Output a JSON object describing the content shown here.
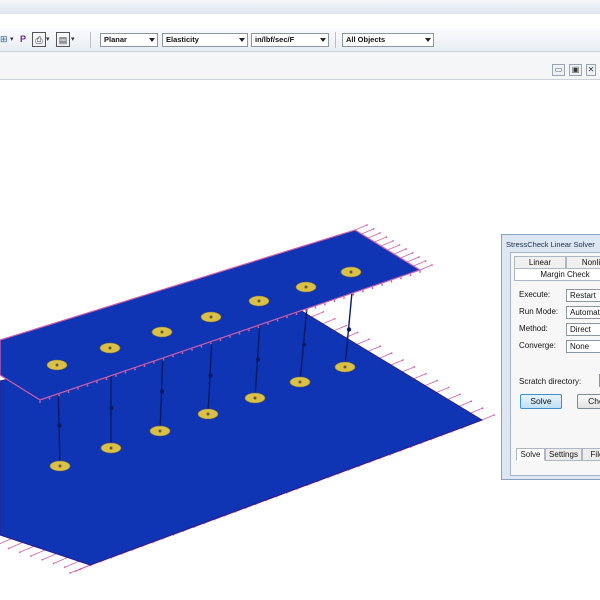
{
  "toolbar": {
    "p_label": "P",
    "analysis_type": "Planar",
    "material_model": "Elasticity",
    "units": "in/lbf/sec/F",
    "object_filter": "All Objects"
  },
  "window_controls": {
    "minimize": "▭",
    "restore": "▣",
    "close": "✕"
  },
  "solver_panel": {
    "title": "StressCheck Linear Solver",
    "tabs_top": [
      "Linear",
      "Nonli"
    ],
    "tab_margin": "Margin Check",
    "fields": [
      {
        "label": "Execute:",
        "value": "Restart"
      },
      {
        "label": "Run Mode:",
        "value": "Automatic"
      },
      {
        "label": "Method:",
        "value": "Direct"
      },
      {
        "label": "Converge:",
        "value": "None"
      }
    ],
    "scratch_label": "Scratch directory:",
    "solve_button": "Solve",
    "check_button": "Chec",
    "bottom_tabs": [
      "Solve",
      "Settings",
      "File"
    ]
  },
  "colors": {
    "plate": "#0f34b4",
    "plate_edge": "#2b1f8c",
    "load_arrow": "#d260a8",
    "fastener": "#d9c04a",
    "fastener_line": "#0c1a66"
  }
}
